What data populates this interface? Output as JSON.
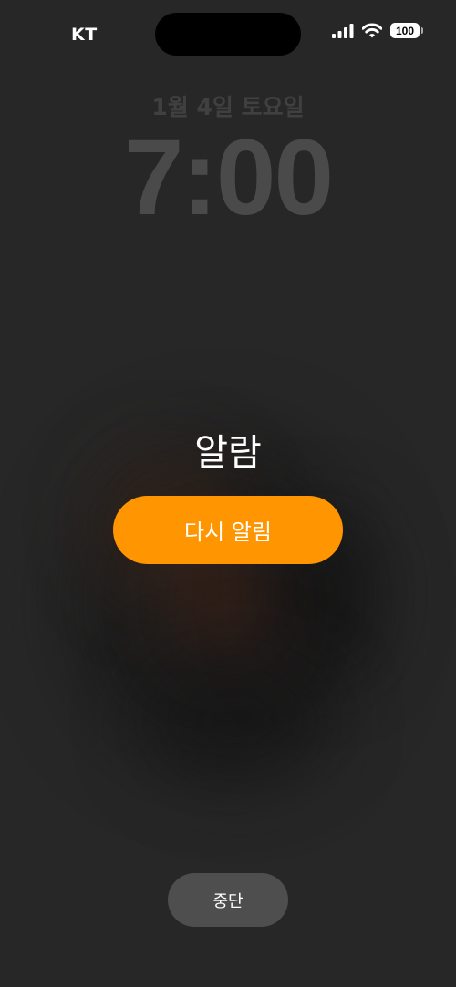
{
  "status_bar": {
    "carrier": "KT",
    "battery": "100",
    "icons": [
      "signal-bars-icon",
      "wifi-icon",
      "battery-icon"
    ]
  },
  "lock_screen": {
    "date": "1월 4일 토요일",
    "time": "7:00"
  },
  "alarm": {
    "label": "알람",
    "snooze_label": "다시 알림",
    "stop_label": "중단"
  },
  "colors": {
    "snooze": "#ff9500",
    "stop": "#4e4e4e",
    "background": "#272727"
  }
}
